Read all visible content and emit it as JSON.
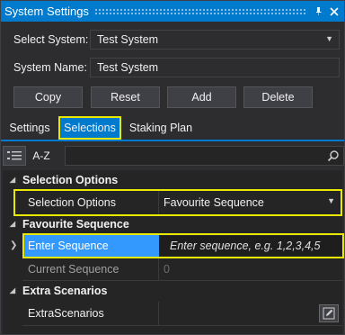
{
  "window": {
    "title": "System Settings",
    "pin_icon": "pin-icon",
    "close_icon": "close-icon"
  },
  "form": {
    "select_system_label": "Select System:",
    "select_system_value": "Test System",
    "system_name_label": "System Name:",
    "system_name_value": "Test System"
  },
  "buttons": {
    "copy": "Copy",
    "reset": "Reset",
    "add": "Add",
    "delete": "Delete"
  },
  "tabs": [
    {
      "label": "Settings",
      "active": false
    },
    {
      "label": "Selections",
      "active": true
    },
    {
      "label": "Staking Plan",
      "active": false
    }
  ],
  "toolbar": {
    "categorized_icon": "categorized-list-icon",
    "az_label": "A-Z",
    "search_placeholder": "",
    "search_icon": "search-icon"
  },
  "property_grid": {
    "categories": [
      {
        "name": "Selection Options",
        "properties": [
          {
            "name": "Selection Options",
            "value": "Favourite Sequence",
            "editor": "dropdown"
          }
        ]
      },
      {
        "name": "Favourite Sequence",
        "properties": [
          {
            "name": "Enter Sequence",
            "value": "Enter sequence, e.g. 1,2,3,4,5",
            "editor": "text",
            "selected": true
          },
          {
            "name": "Current Sequence",
            "value": "0",
            "editor": "readonly"
          }
        ]
      },
      {
        "name": "Extra Scenarios",
        "properties": [
          {
            "name": "ExtraScenarios",
            "value": "",
            "editor": "edit-button",
            "icon": "pencil-icon"
          }
        ]
      }
    ]
  },
  "colors": {
    "accent": "#007acc",
    "highlight_outline": "#e8e800",
    "background": "#2d2d30",
    "grid_background": "#252526"
  }
}
